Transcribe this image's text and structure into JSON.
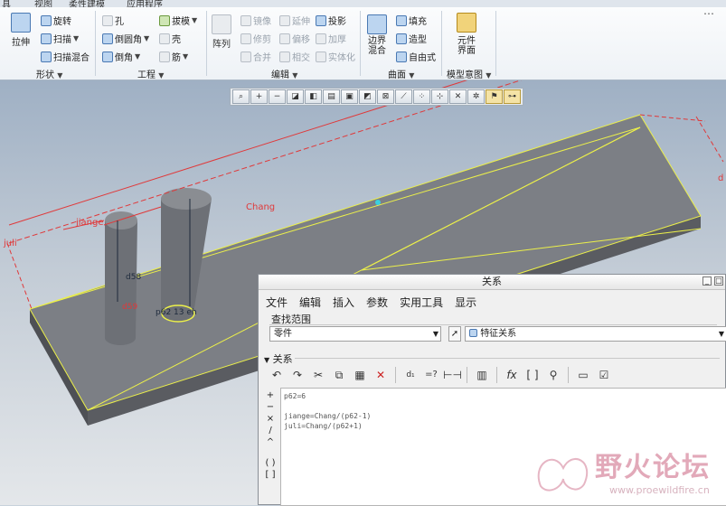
{
  "ribbon": {
    "tabs": [
      "具",
      "视图",
      "柔性建模",
      "应用程序"
    ],
    "groups": {
      "shape": {
        "label": "形状",
        "extrude": "拉伸",
        "revolve": "旋转",
        "sweep": "扫描",
        "swept_blend": "扫描混合"
      },
      "engineering": {
        "label": "工程",
        "hole": "孔",
        "round": "倒圆角",
        "chamfer": "倒角",
        "draft": "拔模",
        "shell": "壳",
        "rib": "筋"
      },
      "editing": {
        "label": "编辑",
        "pattern": "阵列",
        "mirror": "镜像",
        "trim": "修剪",
        "merge": "合并",
        "extend": "延伸",
        "offset": "偏移",
        "intersect": "相交",
        "project": "投影",
        "thicken": "加厚",
        "solidify": "实体化"
      },
      "surfaces": {
        "label": "曲面",
        "boundary_blend": "边界混合",
        "fill": "填充",
        "style": "造型",
        "freestyle": "自由式"
      },
      "model_intent": {
        "label": "模型意图",
        "component_interface": "元件界面"
      }
    }
  },
  "viewport": {
    "dims": {
      "chang": "Chang",
      "jiange": "jiange",
      "juli": "juli",
      "d58": "d58",
      "d59": "d59",
      "p62": "p62 13 eh",
      "d_right": "d"
    },
    "colors": {
      "dim_red": "#e0393a",
      "edge_yellow": "#ecf04a",
      "body_gray": "#7c7f85"
    }
  },
  "dialog": {
    "title": "关系",
    "menu": [
      "文件",
      "编辑",
      "插入",
      "参数",
      "实用工具",
      "显示"
    ],
    "lookin": {
      "label": "查找范围",
      "scope_value": "零件",
      "feature_value": "特征关系"
    },
    "relations": {
      "header": "关系",
      "tools": [
        "undo-icon",
        "redo-icon",
        "cut-icon",
        "copy-icon",
        "paste-icon",
        "delete-icon",
        "switch-dims-icon",
        "evaluate-icon",
        "insert-dim-icon",
        "sort-icon",
        "function-icon",
        "parameters-icon",
        "verify-icon",
        "local-params-icon",
        "check-icon"
      ],
      "side_tools": [
        "+",
        "−",
        "×",
        "/",
        "^",
        "( )",
        "[ ]"
      ],
      "lines": [
        "p62=6",
        "",
        "jiange=Chang/(p62-1)",
        "juli=Chang/(p62+1)"
      ]
    }
  },
  "watermark": {
    "name": "野火论坛",
    "url": "www.proewildfire.cn"
  }
}
